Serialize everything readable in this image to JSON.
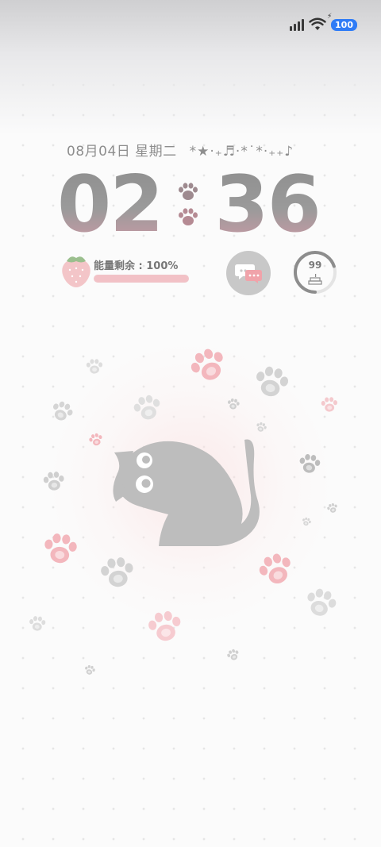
{
  "status_bar": {
    "signal_icon": "cellular-signal-icon",
    "wifi_icon": "wifi-icon",
    "battery_level": "100",
    "charging_mark": "⚡"
  },
  "lockscreen": {
    "date": "08月04日",
    "weekday": "星期二",
    "decoration": "*★·₊♬·*˙*·₊₊♪",
    "hours": "02",
    "minutes": "36",
    "separator_icons": [
      "paw-icon",
      "paw-icon"
    ]
  },
  "energy_widget": {
    "label": "能量剩余 : 100%",
    "level": 1.0,
    "icon": "strawberry-icon"
  },
  "message_widget": {
    "icon": "chat-bubbles-icon"
  },
  "ring_widget": {
    "value": "99",
    "icon": "cake-icon",
    "progress": 0.7
  },
  "colors": {
    "accent_pink": "#f2b9bf",
    "paw_gray": "#c9c9c9",
    "cat_gray": "#bdbdbd",
    "battery_blue": "#2f7cf6"
  }
}
